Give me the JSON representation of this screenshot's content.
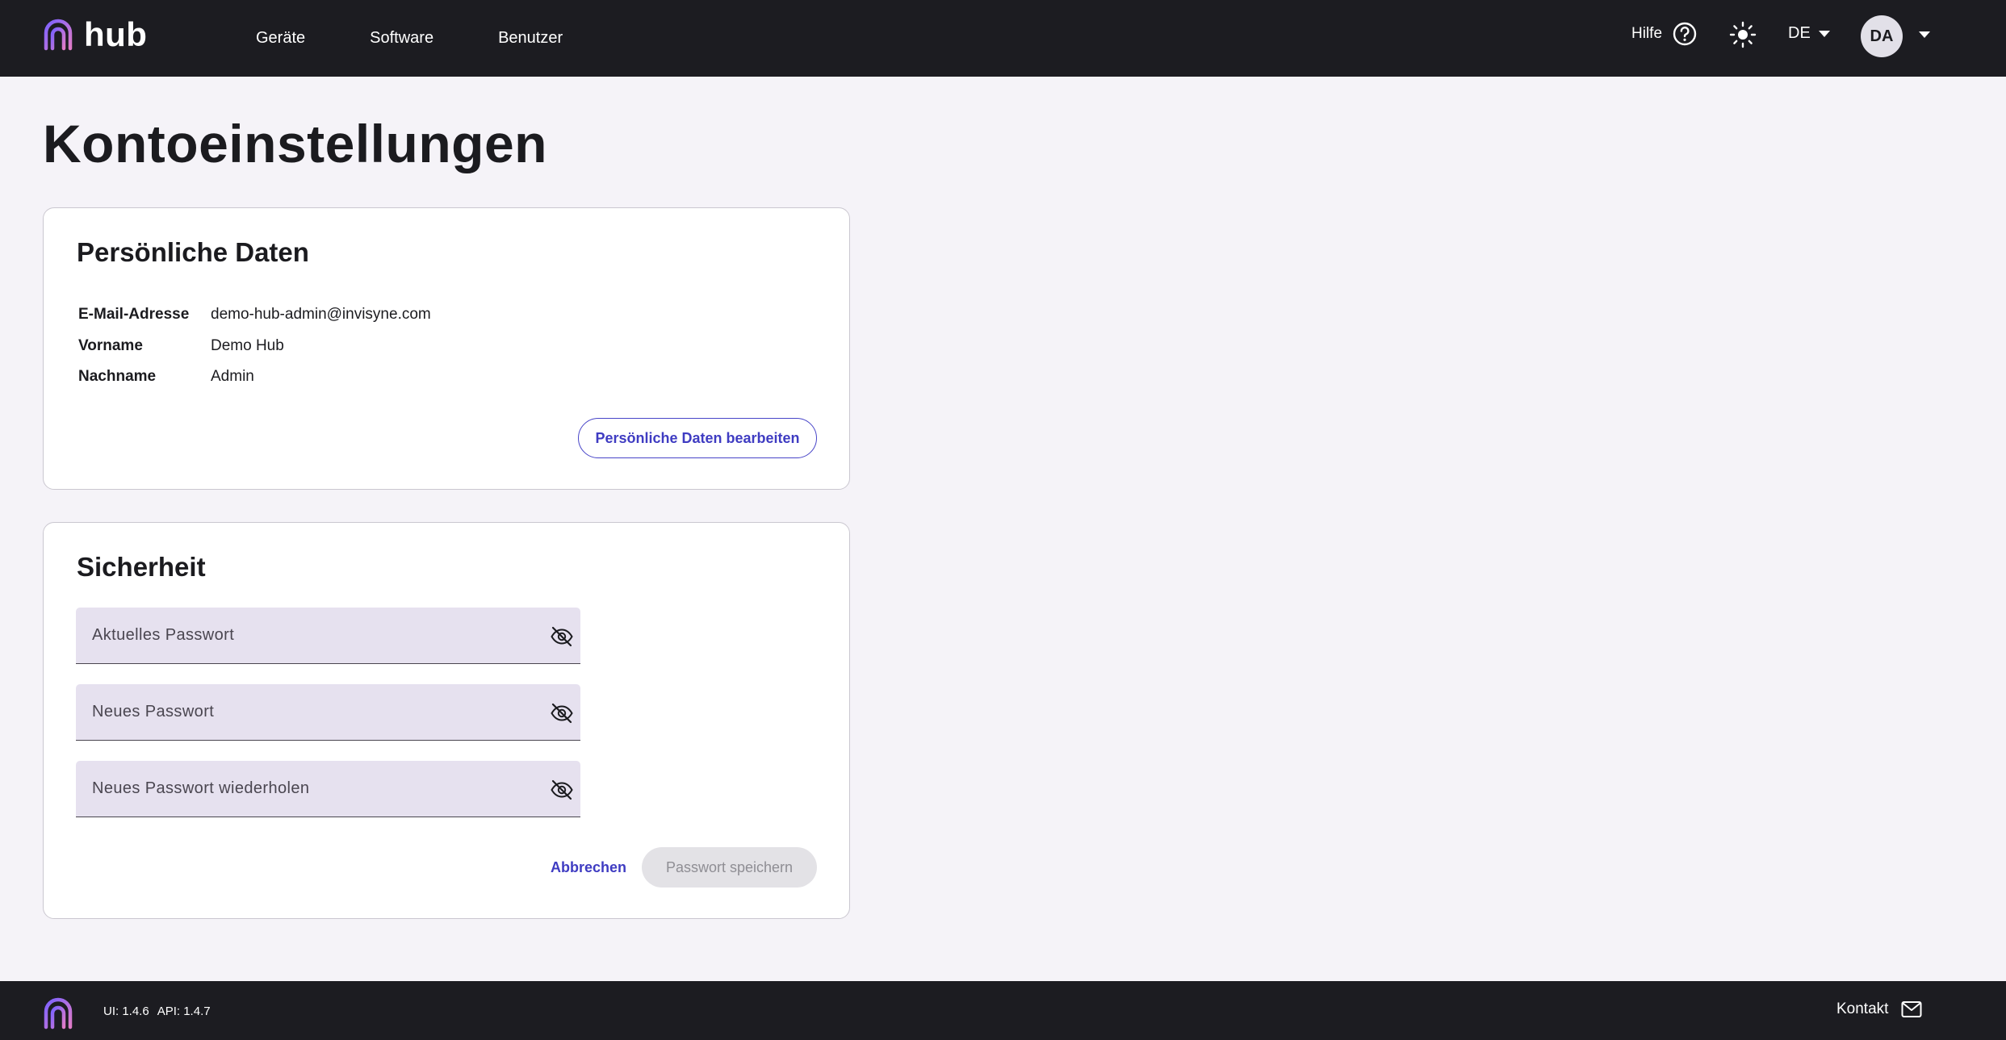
{
  "header": {
    "brand_text": "hub",
    "nav": [
      {
        "label": "Geräte"
      },
      {
        "label": "Software"
      },
      {
        "label": "Benutzer"
      }
    ],
    "help_label": "Hilfe",
    "language": "DE",
    "avatar_initials": "DA"
  },
  "page": {
    "title": "Kontoeinstellungen"
  },
  "personal": {
    "title": "Persönliche Daten",
    "rows": [
      {
        "label": "E-Mail-Adresse",
        "value": "demo-hub-admin@invisyne.com"
      },
      {
        "label": "Vorname",
        "value": "Demo Hub"
      },
      {
        "label": "Nachname",
        "value": "Admin"
      }
    ],
    "edit_button": "Persönliche Daten bearbeiten"
  },
  "security": {
    "title": "Sicherheit",
    "fields": [
      {
        "placeholder": "Aktuelles Passwort",
        "value": ""
      },
      {
        "placeholder": "Neues Passwort",
        "value": ""
      },
      {
        "placeholder": "Neues Passwort wiederholen",
        "value": ""
      }
    ],
    "cancel_button": "Abbrechen",
    "save_button": "Passwort speichern"
  },
  "footer": {
    "ui_version": "UI: 1.4.6",
    "api_version": "API: 1.4.7",
    "contact_label": "Kontakt"
  },
  "colors": {
    "nav_background": "#1c1c21",
    "page_background": "#f5f3f8",
    "accent": "#4845c8",
    "field_background": "#e6e1ef",
    "logo_gradient_start": "#7b61ff",
    "logo_gradient_end": "#e07cc8"
  },
  "icons": {
    "help": "help-circle-icon",
    "theme": "sun-icon",
    "password_toggle": "eye-off-icon",
    "contact": "mail-icon",
    "logo": "hub-logo-icon"
  }
}
